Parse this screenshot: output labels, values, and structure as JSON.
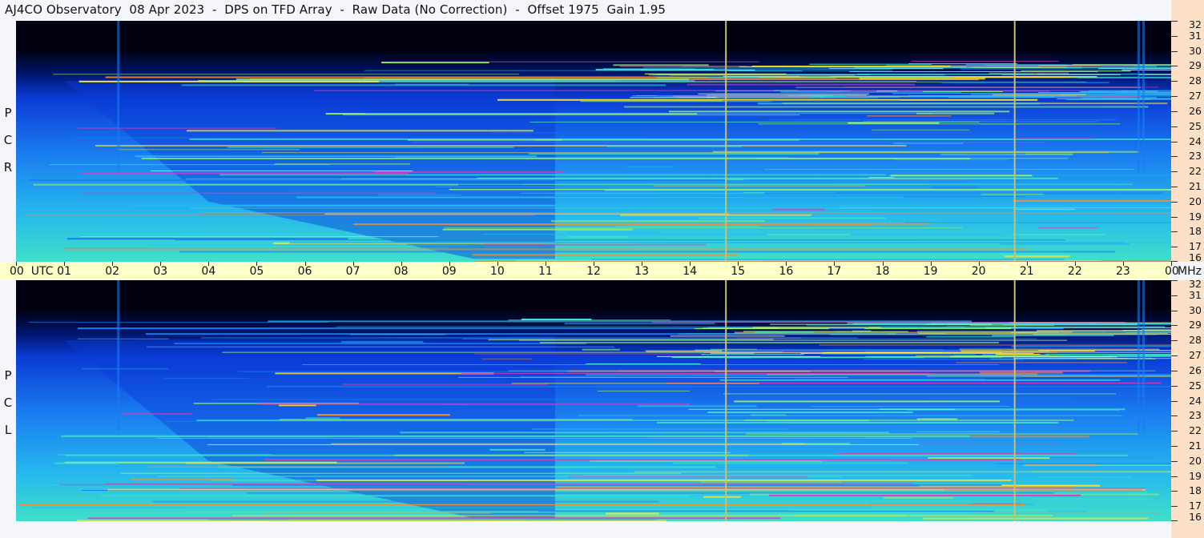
{
  "title": "AJ4CO Observatory  08 Apr 2023  -  DPS on TFD Array  -  Raw Data (No Correction)  -  Offset 1975  Gain 1.95",
  "panels": [
    {
      "polarization": [
        "R",
        "C",
        "P"
      ]
    },
    {
      "polarization": [
        "L",
        "C",
        "P"
      ]
    }
  ],
  "colors": {
    "background": "#f4f6fb",
    "time_axis": "#ffffc8",
    "freq_axis": "#fde0c8",
    "colormap": [
      "#000010",
      "#00156b",
      "#0a3bd6",
      "#1a7cf0",
      "#25b8ee",
      "#3fe0c8",
      "#9af06a",
      "#f7e23a",
      "#ff8a2a",
      "#e23ab8"
    ]
  },
  "chart_data": {
    "type": "heatmap",
    "title": "AJ4CO Observatory  08 Apr 2023  -  DPS on TFD Array  -  Raw Data (No Correction)  -  Offset 1975  Gain 1.95",
    "x_axis": {
      "ticks": [
        "00",
        "01",
        "02",
        "03",
        "04",
        "05",
        "06",
        "07",
        "08",
        "09",
        "10",
        "11",
        "12",
        "13",
        "14",
        "15",
        "16",
        "17",
        "18",
        "19",
        "20",
        "21",
        "22",
        "23",
        "00"
      ],
      "first_tick_suffix": "UTC",
      "range_hours": [
        0,
        24
      ]
    },
    "y_axis": {
      "ticks": [
        "16",
        "17",
        "18",
        "19",
        "20",
        "21",
        "22",
        "23",
        "24",
        "25",
        "26",
        "27",
        "28",
        "29",
        "30",
        "31",
        "32"
      ],
      "unit": "MHz",
      "range": [
        16,
        32
      ]
    },
    "panels": [
      "RCP",
      "LCP"
    ],
    "marker_lines_utc_hours": [
      14.75,
      20.75
    ],
    "noise_floor_dark_above_mhz": 28.5
  }
}
